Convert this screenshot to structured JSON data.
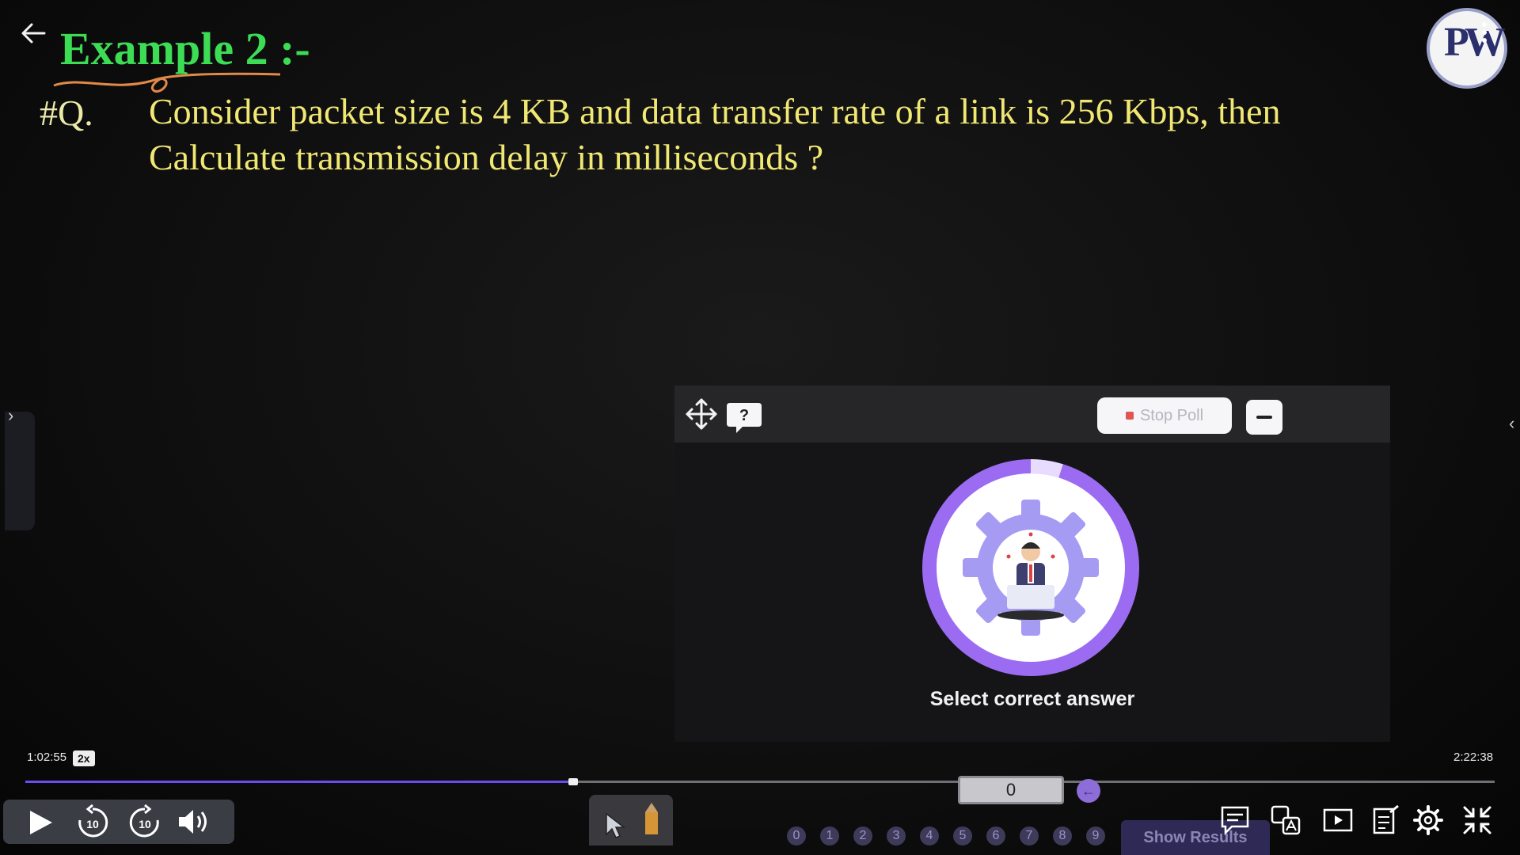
{
  "slide": {
    "title": "Example 2 :-",
    "question_prefix": "#Q.",
    "question_line1": "Consider packet size is 4 KB and data transfer rate of a link is 256 Kbps, then",
    "question_line2": "Calculate transmission delay in milliseconds ?",
    "logo_text": "PW"
  },
  "poll": {
    "stop_label": "Stop Poll",
    "caption": "Select correct answer",
    "answer_value": "0",
    "options": [
      "0",
      "1",
      "2",
      "3",
      "4",
      "5",
      "6",
      "7",
      "8",
      "9"
    ],
    "show_results_label": "Show Results",
    "accent_color": "#9b6cf2"
  },
  "player": {
    "current_time": "1:02:55",
    "speed": "2x",
    "total_time": "2:22:38",
    "progress": 0.3731,
    "rewind_label": "10",
    "forward_label": "10",
    "progress_color": "#6a4cf0"
  },
  "icons": {
    "back": "arrow-left-icon",
    "more": "kebab-icon",
    "move": "move-arrows-icon",
    "help": "question-bubble-icon",
    "play": "play-icon",
    "volume": "volume-icon",
    "pointer": "pointer-icon",
    "pencil": "pencil-icon",
    "captions": "captions-icon",
    "translate": "translate-icon",
    "pip": "picture-in-picture-icon",
    "notes": "notes-icon",
    "settings": "gear-icon",
    "exit_fullscreen": "exit-fullscreen-icon"
  }
}
